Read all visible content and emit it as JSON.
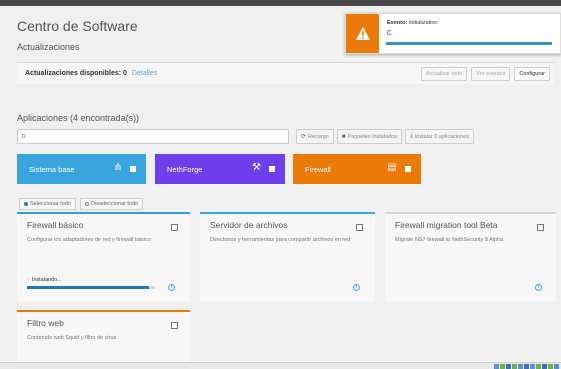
{
  "header": {
    "title": "Centro de Software"
  },
  "updates": {
    "section_title": "Actualizaciones",
    "available_label": "Actualizaciones disponibles: 0",
    "details_link": "Detalles",
    "update_all_button": "Actualizar todo",
    "view_events_button": "Ver eventos",
    "configure_button": "Configurar"
  },
  "apps": {
    "section_title": "Aplicaciones (4 encontrada(s))",
    "search_value": "fi",
    "reload_button": "Recargo",
    "installed_packages_button": "Paquetes instalados",
    "install_button": "Instalar 0 aplicaciones",
    "select_all_button": "Seleccionar todo",
    "deselect_all_button": "Deseleccionar todo"
  },
  "categories": [
    {
      "label": "Sistema base",
      "color": "#39a5dc",
      "icon": "network-icon"
    },
    {
      "label": "NethForge",
      "color": "#703fec",
      "icon": "tools-icon"
    },
    {
      "label": "Firewall",
      "color": "#ec7a08",
      "icon": "firewall-icon"
    }
  ],
  "cards": [
    {
      "title": "Firewall básico",
      "description": "Configurar los adaptadores de red y firewall básico",
      "status": "Instalando...",
      "progress": 0.95
    },
    {
      "title": "Servidor de archivos",
      "description": "Directorios y herramientas para compartir archivos en red"
    },
    {
      "title": "Firewall migration tool Beta",
      "description": "Migrate NS7 firewall to NethSecurity 8 Alpha"
    },
    {
      "title": "Filtro web",
      "description": "Contenido web Squid y filtro de virus"
    }
  ],
  "toast": {
    "label": "Evento:",
    "value": "Initialization",
    "icon": "warning-icon",
    "color": "#ec7a08",
    "progress": 1.0
  }
}
